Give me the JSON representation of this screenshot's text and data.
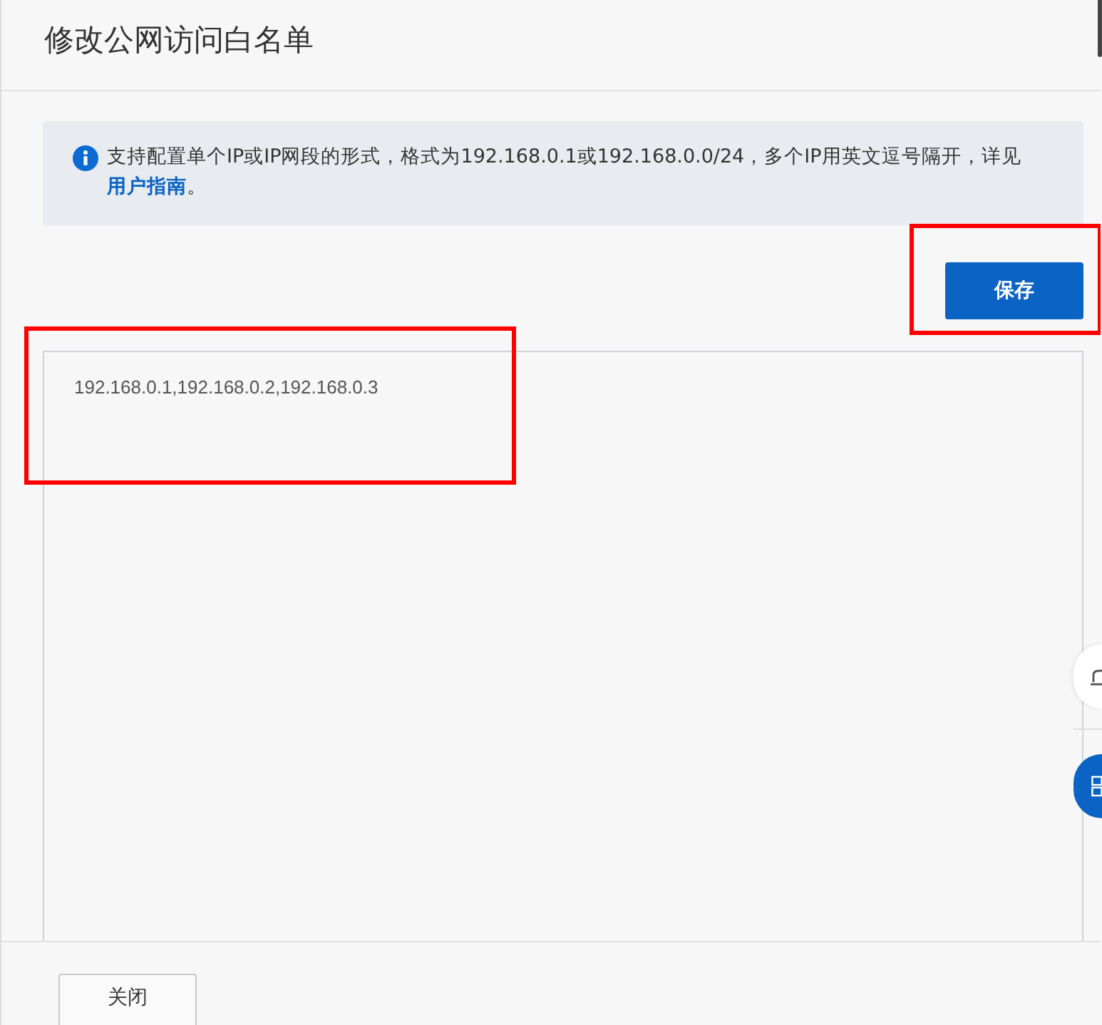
{
  "dialog": {
    "title": "修改公网访问白名单"
  },
  "notice": {
    "text": "支持配置单个IP或IP网段的形式，格式为192.168.0.1或192.168.0.0/24，多个IP用英文逗号隔开，详见",
    "link": "用户指南",
    "suffix": "。"
  },
  "save_button": {
    "label": "保存",
    "highlighted": true
  },
  "whitelist_field": {
    "value": "192.168.0.1,192.168.0.2,192.168.0.3",
    "highlighted": true
  },
  "footer": {
    "close_button": "关闭"
  }
}
